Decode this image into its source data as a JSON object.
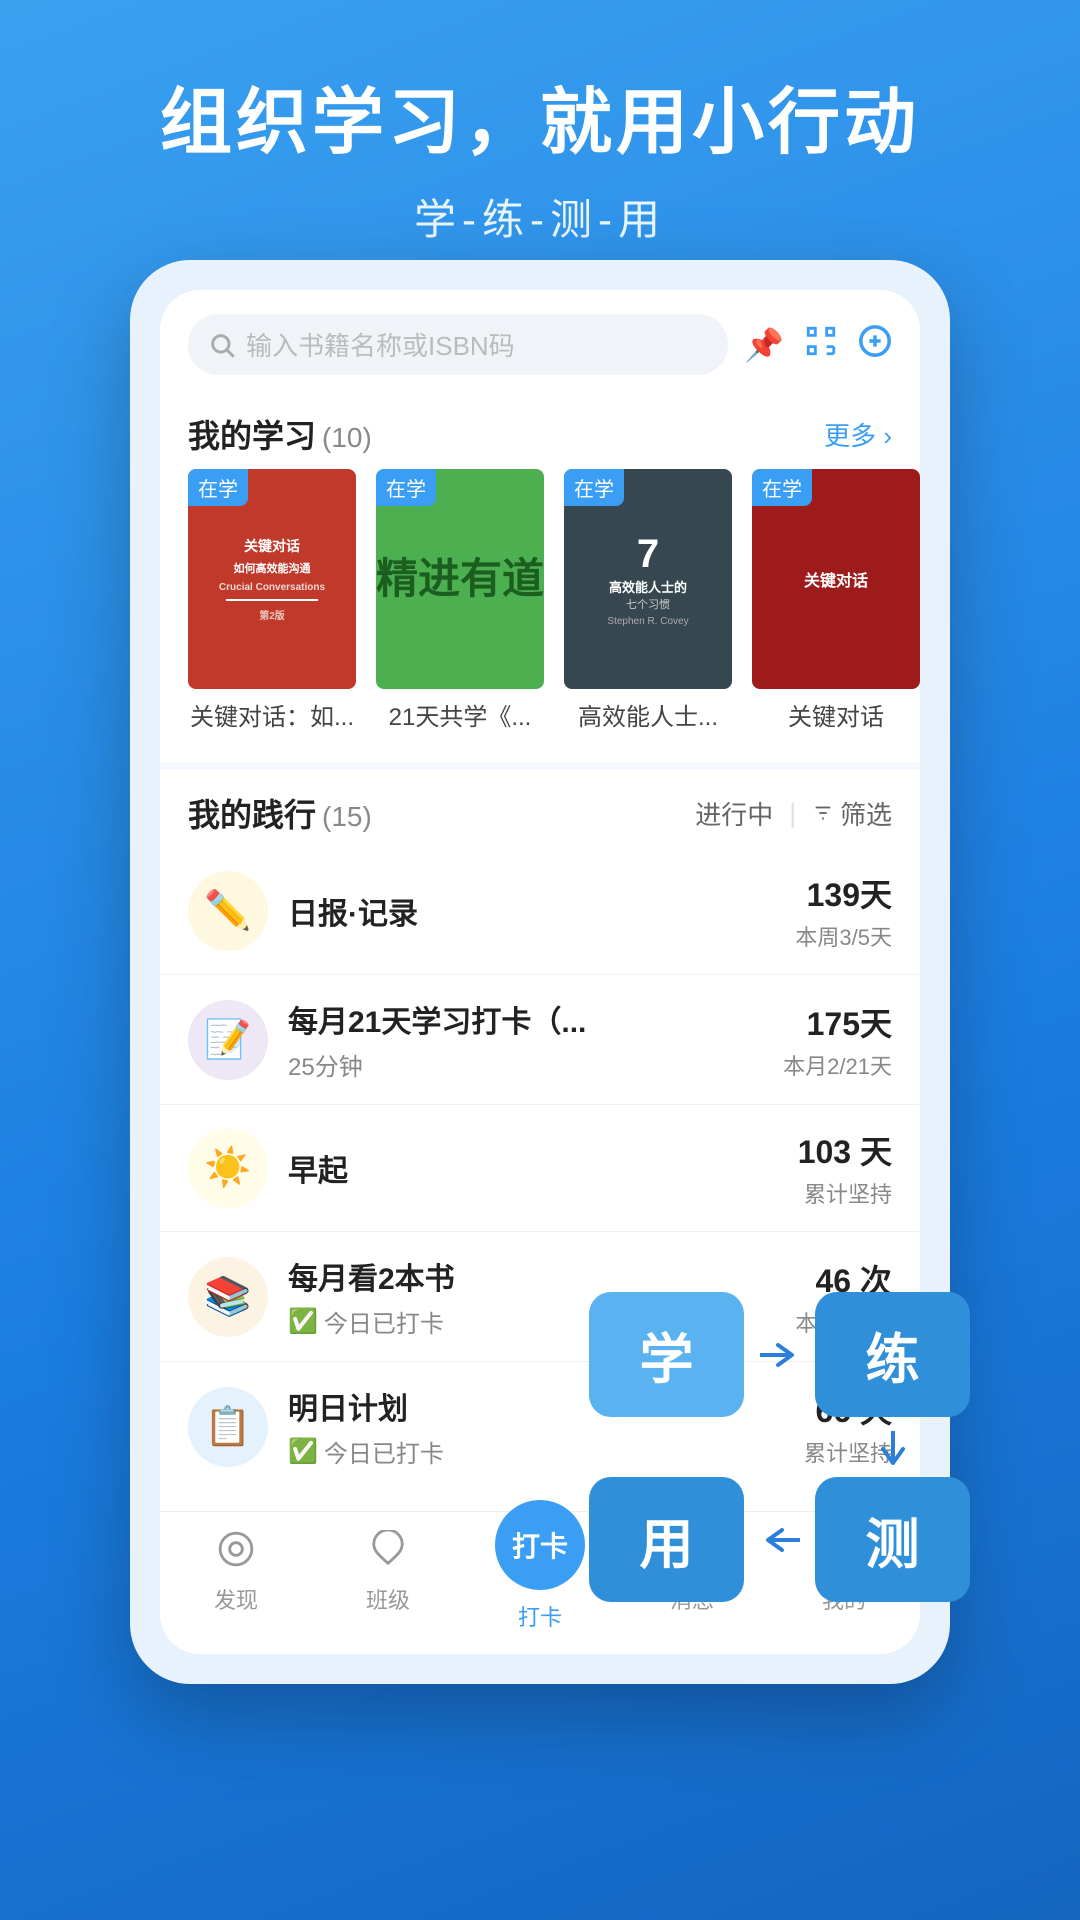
{
  "hero": {
    "title": "组织学习，就用小行动",
    "subtitle": "学-练-测-用"
  },
  "search": {
    "placeholder": "输入书籍名称或ISBN码"
  },
  "myLearning": {
    "title": "我的学习",
    "count": "(10)",
    "more": "更多 ›",
    "books": [
      {
        "badge": "在学",
        "name": "关键对话：如...",
        "cover": "red",
        "title": "关键对话",
        "sub": "如何高效能沟通"
      },
      {
        "badge": "在学",
        "name": "21天共学《...",
        "cover": "green",
        "title": "精进有道",
        "sub": ""
      },
      {
        "badge": "在学",
        "name": "高效能人士...",
        "cover": "dark",
        "title": "7 HABITS",
        "sub": "高效能人士的七个习惯"
      },
      {
        "badge": "在学",
        "name": "关键对话",
        "cover": "darkred",
        "title": "...",
        "sub": ""
      }
    ]
  },
  "myPractice": {
    "title": "我的践行",
    "count": "(15)",
    "statusLabel": "进行中",
    "filterLabel": "筛选",
    "items": [
      {
        "icon": "✏️",
        "iconBg": "icon-bg-yellow",
        "name": "日报·记录",
        "sub": "",
        "days": "139天",
        "detail": "本周3/5天"
      },
      {
        "icon": "📝",
        "iconBg": "icon-bg-lavender",
        "name": "每月21天学习打卡（...",
        "sub": "25分钟",
        "days": "175天",
        "detail": "本月2/21天"
      },
      {
        "icon": "☀️",
        "iconBg": "icon-bg-lightyellow",
        "name": "早起",
        "sub": "",
        "days": "103 天",
        "detail": "累计坚持"
      },
      {
        "icon": "📚",
        "iconBg": "icon-bg-beige",
        "name": "每月看2本书",
        "sub": "✅ 今日已打卡",
        "days": "46 次",
        "detail": "本月1/2次"
      },
      {
        "icon": "📋",
        "iconBg": "icon-bg-lightblue",
        "name": "明日计划",
        "sub": "✅ 今日已打卡",
        "days": "66 天",
        "detail": "累计坚持"
      }
    ]
  },
  "floatButtons": {
    "learn": "学",
    "practice": "练",
    "use": "用",
    "test": "测"
  },
  "bottomNav": {
    "items": [
      {
        "label": "发现",
        "icon": "🔍",
        "active": false
      },
      {
        "label": "班级",
        "icon": "♡",
        "active": false
      },
      {
        "label": "打卡",
        "icon": "打卡",
        "active": true,
        "center": true
      },
      {
        "label": "消息",
        "icon": "💬",
        "active": false
      },
      {
        "label": "我的",
        "icon": "☺",
        "active": false
      }
    ]
  }
}
